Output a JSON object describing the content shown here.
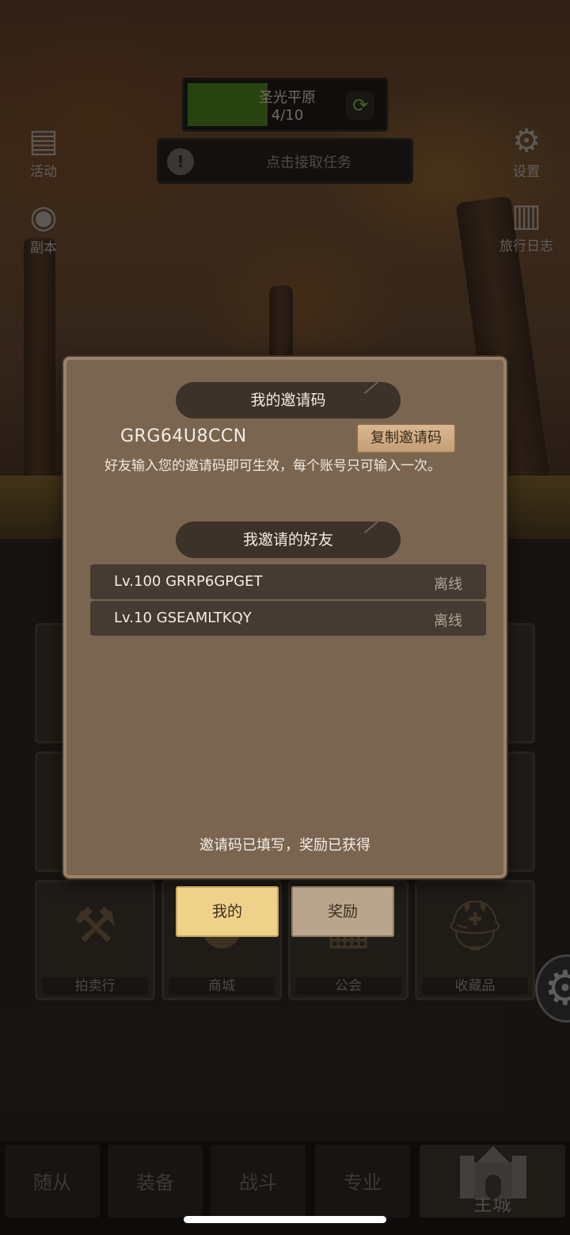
{
  "zone": {
    "name": "圣光平原",
    "progress_text": "4/10",
    "progress": 0.4
  },
  "quest": {
    "label": "点击接取任务"
  },
  "side_buttons": {
    "activity": "活动",
    "dungeon": "副本",
    "settings": "设置",
    "travel_log": "旅行日志"
  },
  "hub_tiles": [
    {
      "label": "拍卖行",
      "icon": "auction-hammer-icon"
    },
    {
      "label": "商城",
      "icon": "coin-icon"
    },
    {
      "label": "公会",
      "icon": "guild-building-icon"
    },
    {
      "label": "收藏品",
      "icon": "helmet-icon"
    }
  ],
  "nav": {
    "items": [
      "随从",
      "装备",
      "战斗",
      "专业",
      "主城"
    ],
    "active": "主城"
  },
  "dialog": {
    "my_code_title": "我的邀请码",
    "invite_code": "GRG64U8CCN",
    "copy_label": "复制邀请码",
    "hint": "好友输入您的邀请码即可生效，每个账号只可输入一次。",
    "friends_title": "我邀请的好友",
    "friends": [
      {
        "name": "Lv.100 GRRP6GPGET",
        "status": "离线"
      },
      {
        "name": "Lv.10 GSEAMLTKQY",
        "status": "离线"
      }
    ],
    "footer_note": "邀请码已填写，奖励已获得",
    "tabs": {
      "mine": "我的",
      "reward": "奖励"
    }
  },
  "colors": {
    "dialog_bg": "#7a6550",
    "banner_bg": "#3c322a",
    "active_tab": "#efd28a",
    "progress_green": "#4a7a1e"
  }
}
